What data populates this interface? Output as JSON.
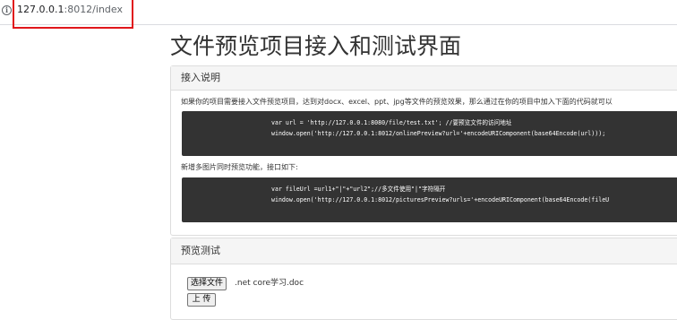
{
  "browser": {
    "url_host": "127.0.0.1",
    "url_path": ":8012/index",
    "info_icon": "info-icon",
    "highlight_color": "#e0161b"
  },
  "page": {
    "title": "文件预览项目接入和测试界面"
  },
  "integration_panel": {
    "heading": "接入说明",
    "description_single": "如果你的项目需要接入文件预览项目，达到对docx、excel、ppt、jpg等文件的预览效果，那么通过在你的项目中加入下面的代码就可以",
    "code_single": [
      "var url = 'http://127.0.0.1:8080/file/test.txt'; //要预览文件的访问地址",
      "window.open('http://127.0.0.1:8012/onlinePreview?url='+encodeURIComponent(base64Encode(url)));"
    ],
    "description_multi": "新增多图片同时预览功能，接口如下:",
    "code_multi": [
      "var fileUrl =url1+\"|\"+\"url2\";//多文件使用\"|\"字符隔开",
      "window.open('http://127.0.0.1:8012/picturesPreview?urls='+encodeURIComponent(base64Encode(fileU"
    ]
  },
  "preview_panel": {
    "heading": "预览测试",
    "choose_file_label": "选择文件",
    "file_name": ".net core学习.doc",
    "upload_label": "上 传"
  },
  "colors": {
    "code_background": "#333333",
    "panel_heading_background": "#f5f5f5",
    "panel_border": "#dddddd"
  }
}
